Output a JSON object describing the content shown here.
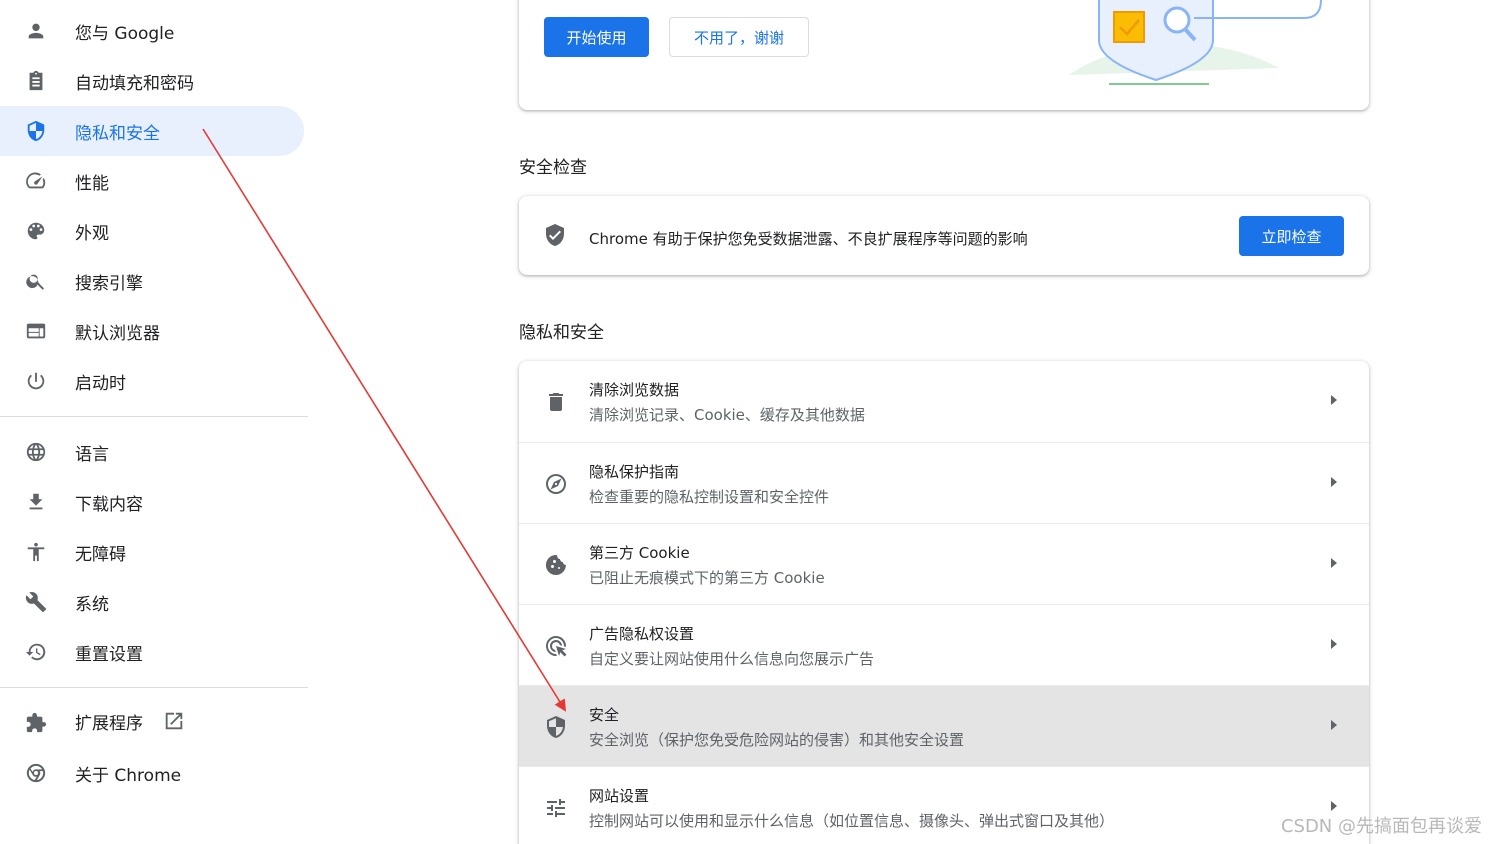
{
  "sidebar": {
    "group1": [
      {
        "label": "您与 Google",
        "icon": "person-icon"
      },
      {
        "label": "自动填充和密码",
        "icon": "clipboard-icon"
      },
      {
        "label": "隐私和安全",
        "icon": "shield-icon",
        "active": true
      },
      {
        "label": "性能",
        "icon": "speedometer-icon"
      },
      {
        "label": "外观",
        "icon": "palette-icon"
      },
      {
        "label": "搜索引擎",
        "icon": "search-icon"
      },
      {
        "label": "默认浏览器",
        "icon": "browser-icon"
      },
      {
        "label": "启动时",
        "icon": "power-icon"
      }
    ],
    "group2": [
      {
        "label": "语言",
        "icon": "globe-icon"
      },
      {
        "label": "下载内容",
        "icon": "download-icon"
      },
      {
        "label": "无障碍",
        "icon": "accessibility-icon"
      },
      {
        "label": "系统",
        "icon": "wrench-icon"
      },
      {
        "label": "重置设置",
        "icon": "history-icon"
      }
    ],
    "group3": [
      {
        "label": "扩展程序",
        "icon": "puzzle-icon",
        "trailing_icon": "open-in-new-icon"
      },
      {
        "label": "关于 Chrome",
        "icon": "chrome-icon"
      }
    ]
  },
  "promo": {
    "start_button": "开始使用",
    "decline_button": "不用了，谢谢"
  },
  "safety_check": {
    "section_title": "安全检查",
    "description": "Chrome 有助于保护您免受数据泄露、不良扩展程序等问题的影响",
    "button": "立即检查"
  },
  "privacy": {
    "section_title": "隐私和安全",
    "rows": [
      {
        "title": "清除浏览数据",
        "subtitle": "清除浏览记录、Cookie、缓存及其他数据",
        "icon": "trash-icon"
      },
      {
        "title": "隐私保护指南",
        "subtitle": "检查重要的隐私控制设置和安全控件",
        "icon": "compass-icon"
      },
      {
        "title": "第三方 Cookie",
        "subtitle": "已阻止无痕模式下的第三方 Cookie",
        "icon": "cookie-icon"
      },
      {
        "title": "广告隐私权设置",
        "subtitle": "自定义要让网站使用什么信息向您展示广告",
        "icon": "ads-click-icon"
      },
      {
        "title": "安全",
        "subtitle": "安全浏览（保护您免受危险网站的侵害）和其他安全设置",
        "icon": "shield-half-icon",
        "hover": true
      },
      {
        "title": "网站设置",
        "subtitle": "控制网站可以使用和显示什么信息（如位置信息、摄像头、弹出式窗口及其他）",
        "icon": "tune-icon"
      }
    ]
  },
  "watermark": "CSDN @先搞面包再谈爱",
  "colors": {
    "accent": "#1a73e8",
    "active_bg": "#e8f0fe",
    "arrow": "#e53935"
  }
}
